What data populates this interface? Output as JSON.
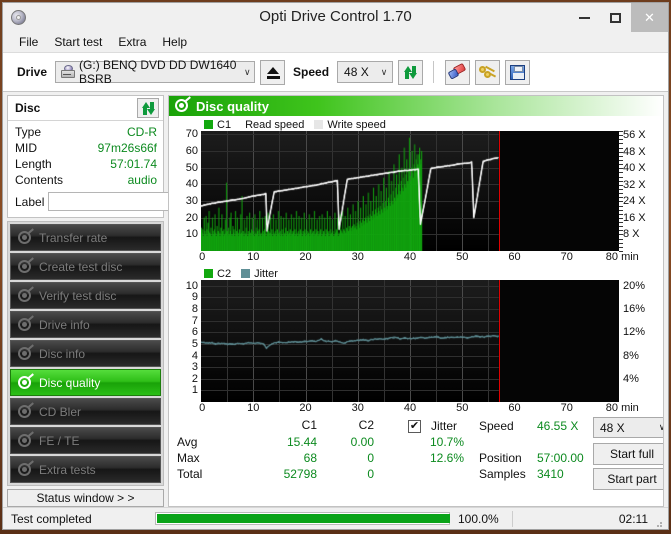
{
  "window": {
    "title": "Opti Drive Control 1.70",
    "app_icon": "disc-icon",
    "minimize": "–",
    "maximize": "□",
    "close": "✕"
  },
  "menu": {
    "items": [
      "File",
      "Start test",
      "Extra",
      "Help"
    ]
  },
  "toolbar": {
    "drive_label": "Drive",
    "drive_value": "(G:)  BENQ DVD DD DW1640 BSRB",
    "eject_title": "eject-button",
    "speed_label": "Speed",
    "speed_value": "48 X",
    "refresh_title": "refresh-button",
    "erase_title": "erase-button",
    "keys_title": "keys-button",
    "save_title": "save-button",
    "dropdown_arrow": "∨"
  },
  "disc_panel": {
    "title": "Disc",
    "refresh_icon": "refresh-icon",
    "rows": [
      {
        "key": "Type",
        "value": "CD-R"
      },
      {
        "key": "MID",
        "value": "97m26s66f"
      },
      {
        "key": "Length",
        "value": "57:01.74"
      },
      {
        "key": "Contents",
        "value": "audio"
      }
    ],
    "label_key": "Label",
    "label_value": "",
    "label_placeholder": "",
    "cd_button_icon": "cd-icon"
  },
  "sidebar": {
    "items": [
      {
        "label": "Transfer rate",
        "active": false
      },
      {
        "label": "Create test disc",
        "active": false
      },
      {
        "label": "Verify test disc",
        "active": false
      },
      {
        "label": "Drive info",
        "active": false
      },
      {
        "label": "Disc info",
        "active": false
      },
      {
        "label": "Disc quality",
        "active": true
      },
      {
        "label": "CD Bler",
        "active": false
      },
      {
        "label": "FE / TE",
        "active": false
      },
      {
        "label": "Extra tests",
        "active": false
      }
    ],
    "status_window_button": "Status window > >"
  },
  "main": {
    "header_title": "Disc quality",
    "header_icon": "disc-quality-icon"
  },
  "chart_data": [
    {
      "type": "area",
      "id": "c1-read-speed-chart",
      "title": "",
      "legend": [
        {
          "label": "C1",
          "color": "#12a80f",
          "swatch": true
        },
        {
          "label": "Read speed",
          "color": "#111111",
          "swatch": false
        },
        {
          "label": "Write speed",
          "color": "#e8e8e8",
          "swatch": true
        }
      ],
      "xlabel": "min",
      "xticks": [
        "0",
        "10",
        "20",
        "30",
        "40",
        "50",
        "60",
        "70",
        "80"
      ],
      "xlim": [
        0,
        80
      ],
      "ylabel_left": "",
      "yticks_left": [
        "10",
        "20",
        "30",
        "40",
        "50",
        "60",
        "70"
      ],
      "ylim_left": [
        0,
        72
      ],
      "ylabel_right": "X",
      "yticks_right": [
        "8 X",
        "16 X",
        "24 X",
        "32 X",
        "40 X",
        "48 X",
        "56 X"
      ],
      "ylim_right": [
        0,
        58
      ],
      "grid": true,
      "cursor_position_min": 57.0,
      "data_end_min": 57.0,
      "series": [
        {
          "name": "C1",
          "color": "#12a80f",
          "kind": "bars",
          "note": "C1 error rate per sample, baseline fill ~8-15, spikes to 68",
          "values": [
            14,
            11,
            13,
            9,
            20,
            12,
            10,
            21,
            13,
            9,
            17,
            12,
            24,
            11,
            10,
            14,
            9,
            20,
            12,
            10,
            13,
            22,
            11,
            9,
            15,
            10,
            12,
            26,
            11,
            9,
            14,
            10,
            22,
            12,
            9,
            13,
            10,
            19,
            11,
            41,
            12,
            9,
            14,
            10,
            20,
            12,
            23,
            10,
            9,
            15,
            11,
            13,
            9,
            24,
            10,
            12,
            20,
            11,
            9,
            13,
            10,
            22,
            11,
            33,
            10,
            12,
            9,
            19,
            11,
            10,
            14,
            21,
            9,
            12,
            10,
            23,
            11,
            9,
            13,
            20,
            10,
            12,
            9,
            22,
            11,
            10,
            14,
            19,
            12,
            9,
            13,
            24,
            10,
            11,
            9,
            20,
            12,
            10,
            13,
            21,
            11,
            9,
            14,
            10,
            23,
            12,
            9,
            11,
            20,
            10,
            13,
            9,
            22,
            11,
            10,
            12,
            19,
            9,
            13,
            10,
            24,
            11,
            9,
            12,
            21,
            10,
            13,
            9,
            20,
            11,
            10,
            14,
            23,
            9,
            12,
            10,
            19,
            11,
            13,
            9,
            22,
            10,
            12,
            11,
            20,
            9,
            13,
            10,
            24,
            11,
            9,
            12,
            21,
            10,
            13,
            11,
            20,
            9,
            12,
            10,
            23,
            11,
            13,
            9,
            19,
            12,
            10,
            11,
            22,
            9,
            13,
            10,
            20,
            11,
            12,
            9,
            24,
            10,
            13,
            11,
            19,
            9,
            12,
            10,
            21,
            11,
            13,
            9,
            22,
            10,
            12,
            11,
            20,
            9,
            13,
            10,
            24,
            11,
            12,
            9,
            21,
            13,
            10,
            11,
            19,
            12,
            9,
            10,
            23,
            11,
            13,
            12,
            20,
            9,
            11,
            10,
            22,
            13,
            12,
            11,
            24,
            10,
            13,
            12,
            21,
            11,
            14,
            13,
            26,
            12,
            15,
            13,
            22,
            14,
            12,
            15,
            28,
            13,
            16,
            14,
            24,
            15,
            13,
            17,
            30,
            16,
            14,
            18,
            26,
            17,
            15,
            19,
            33,
            18,
            16,
            20,
            28,
            19,
            17,
            21,
            35,
            20,
            18,
            22,
            30,
            21,
            19,
            24,
            38,
            22,
            20,
            25,
            33,
            23,
            21,
            26,
            40,
            24,
            22,
            27,
            36,
            25,
            23,
            29,
            44,
            26,
            24,
            30,
            38,
            27,
            25,
            32,
            48,
            29,
            27,
            34,
            42,
            30,
            28,
            36,
            52,
            32,
            30,
            38,
            46,
            34,
            32,
            40,
            58,
            36,
            34,
            42,
            50,
            38,
            36,
            44,
            62,
            40,
            38,
            46,
            55,
            42,
            40,
            48,
            68,
            45,
            42,
            50,
            60,
            47,
            44,
            52,
            64,
            50,
            47,
            55,
            58,
            52,
            50,
            58,
            62,
            55,
            52,
            60,
            0,
            0,
            0,
            0,
            0,
            0,
            0,
            0,
            0,
            0,
            0,
            0,
            0,
            0,
            0,
            0,
            0,
            0,
            0,
            0,
            0,
            0,
            0,
            0,
            0,
            0,
            0,
            0,
            0,
            0,
            0,
            0,
            0,
            0,
            0,
            0,
            0,
            0,
            0,
            0,
            0,
            0,
            0,
            0,
            0,
            0,
            0,
            0,
            0,
            0,
            0,
            0,
            0,
            0,
            0,
            0,
            0,
            0,
            0,
            0,
            0,
            0,
            0,
            0,
            0,
            0,
            0,
            0,
            0,
            0,
            0,
            0,
            0,
            0,
            0,
            0,
            0,
            0,
            0,
            0,
            0,
            0,
            0,
            0,
            0,
            0,
            0,
            0,
            0,
            0,
            0,
            0,
            0,
            0,
            0,
            0,
            0,
            0,
            0,
            0,
            0,
            0,
            0,
            0,
            0,
            0,
            0,
            0,
            0,
            0,
            0,
            0,
            0,
            0,
            0,
            0,
            0,
            0,
            0,
            0
          ]
        },
        {
          "name": "Read speed",
          "color": "#ffffff",
          "kind": "line",
          "note": "CAV stepped read speed with 5 re-calibration drops; rises 27X -> 56X",
          "x_min": [
            0,
            2,
            4,
            6,
            8,
            10,
            12,
            12.4,
            12.6,
            14,
            16,
            18,
            20,
            22,
            24,
            25.8,
            26.1,
            26.4,
            28,
            30,
            32,
            34,
            36,
            38,
            40,
            41.3,
            41.6,
            42,
            44,
            46,
            48,
            50,
            51.5,
            51.8,
            52.2,
            54,
            56,
            56.8
          ],
          "values": [
            27,
            28.5,
            29.5,
            30.5,
            31.5,
            33,
            34,
            34.5,
            12,
            35.5,
            36.5,
            37.5,
            38.5,
            39.5,
            41,
            42,
            42.3,
            13,
            43,
            44,
            45,
            46,
            47,
            48,
            48.5,
            49,
            49.2,
            16,
            49.5,
            50.5,
            51.5,
            52.5,
            53,
            53.5,
            20,
            53.8,
            55.5,
            56
          ]
        }
      ]
    },
    {
      "type": "line",
      "id": "c2-jitter-chart",
      "title": "",
      "legend": [
        {
          "label": "C2",
          "color": "#12a80f",
          "swatch": true
        },
        {
          "label": "Jitter",
          "color": "#5f8f96",
          "swatch": true
        }
      ],
      "xlabel": "min",
      "xticks": [
        "0",
        "10",
        "20",
        "30",
        "40",
        "50",
        "60",
        "70",
        "80"
      ],
      "xlim": [
        0,
        80
      ],
      "yticks_left": [
        "1",
        "2",
        "3",
        "4",
        "5",
        "6",
        "7",
        "8",
        "9",
        "10"
      ],
      "ylim_left": [
        0,
        10.5
      ],
      "yticks_right": [
        "4%",
        "8%",
        "12%",
        "16%",
        "20%"
      ],
      "ylim_right": [
        0,
        21
      ],
      "grid": true,
      "cursor_position_min": 57.0,
      "data_end_min": 57.0,
      "series": [
        {
          "name": "Jitter",
          "color": "#5f8f96",
          "kind": "line",
          "note": "jitter % trace hovering 10.2-11.5% (plotted on 0-10.5 left scale ~5.0-5.8)",
          "x_min": [
            0,
            1,
            2,
            3,
            4,
            5,
            6,
            7,
            8,
            9,
            10,
            11,
            12,
            12.5,
            13,
            14,
            15,
            16,
            17,
            18,
            19,
            20,
            21,
            22,
            23,
            23.5,
            24,
            25,
            26,
            27,
            27.5,
            28,
            29,
            30,
            31,
            32,
            33,
            34,
            35,
            36,
            37,
            37.5,
            38,
            39,
            40,
            41,
            42,
            43,
            44,
            45,
            46,
            47,
            48,
            49,
            50,
            51,
            52,
            53,
            54,
            55,
            56,
            57
          ],
          "values": [
            5.15,
            5.05,
            5.1,
            5.0,
            5.05,
            5.0,
            4.95,
            5.05,
            5.0,
            5.1,
            5.05,
            5.1,
            5.0,
            4.6,
            4.85,
            5.1,
            5.15,
            5.1,
            5.15,
            5.2,
            5.15,
            5.2,
            5.25,
            5.2,
            5.4,
            5.3,
            5.25,
            5.2,
            5.25,
            5.1,
            5.05,
            5.2,
            5.25,
            5.3,
            5.35,
            5.3,
            5.4,
            5.45,
            5.4,
            5.5,
            5.6,
            5.55,
            5.45,
            5.5,
            5.45,
            5.5,
            5.55,
            5.5,
            5.55,
            5.6,
            5.5,
            5.55,
            5.6,
            5.55,
            5.6,
            5.55,
            5.6,
            5.65,
            5.6,
            5.65,
            5.7,
            5.65
          ]
        },
        {
          "name": "C2",
          "color": "#12a80f",
          "kind": "bars",
          "note": "all zero",
          "values": []
        }
      ]
    }
  ],
  "stats": {
    "col_headers": [
      "C1",
      "C2"
    ],
    "row_labels": [
      "Avg",
      "Max",
      "Total"
    ],
    "c1": {
      "avg": "15.44",
      "max": "68",
      "total": "52798"
    },
    "c2": {
      "avg": "0.00",
      "max": "0",
      "total": "0"
    },
    "jitter": {
      "checkbox_label": "Jitter",
      "checked": true,
      "check_glyph": "✔",
      "avg": "10.7%",
      "max": "12.6%"
    },
    "readout": [
      {
        "key": "Speed",
        "value": "46.55 X"
      },
      {
        "key": "Position",
        "value": "57:00.00"
      },
      {
        "key": "Samples",
        "value": "3410"
      }
    ],
    "speed_select": "48 X",
    "dropdown_arrow": "∨",
    "start_full_button": "Start full",
    "start_part_button": "Start part"
  },
  "statusbar": {
    "text": "Test completed",
    "progress_percent": "100.0%",
    "progress_value": 100,
    "elapsed": "02:11"
  },
  "colors": {
    "accent_green": "#19a208",
    "value_green": "#0c8a1f",
    "c1_green": "#12a80f",
    "jitter_teal": "#5f8f96",
    "cursor_red": "#e00000",
    "plot_bg": "#111111"
  }
}
